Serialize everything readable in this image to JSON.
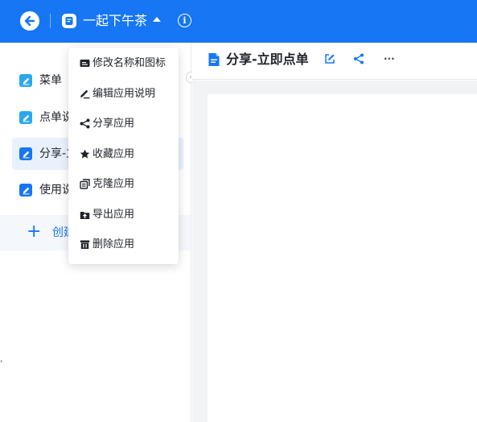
{
  "topbar": {
    "app_title": "一起下午茶",
    "back_icon": "back-arrow-icon",
    "app_icon": "app-badge-icon",
    "caret_icon": "caret-up-icon",
    "info_icon": "info-icon",
    "info_glyph": "i",
    "background_color": "#1676f3"
  },
  "sidebar": {
    "items": [
      {
        "label": "菜单",
        "icon": "edit-square-icon",
        "active": false
      },
      {
        "label": "点单说",
        "icon": "edit-square-icon",
        "active": false
      },
      {
        "label": "分享-立",
        "icon": "edit-square-icon",
        "active": true
      },
      {
        "label": "使用说",
        "icon": "edit-square-icon",
        "active": false
      }
    ],
    "create": {
      "plus": "+",
      "label": "创建"
    },
    "collapse_glyph": "‹"
  },
  "main": {
    "page_title": "分享-立即点单",
    "more_glyph": "···"
  },
  "menu": {
    "items": [
      {
        "label": "修改名称和图标",
        "icon": "rename-card-icon"
      },
      {
        "label": "编辑应用说明",
        "icon": "edit-pen-icon"
      },
      {
        "label": "分享应用",
        "icon": "share-icon"
      },
      {
        "label": "收藏应用",
        "icon": "star-icon"
      },
      {
        "label": "克隆应用",
        "icon": "clone-icon"
      },
      {
        "label": "导出应用",
        "icon": "export-icon"
      },
      {
        "label": "删除应用",
        "icon": "trash-icon"
      }
    ]
  },
  "colors": {
    "accent": "#1676f3",
    "active_bg": "#e9f1fd",
    "canvas_bg": "#f2f3f5"
  }
}
